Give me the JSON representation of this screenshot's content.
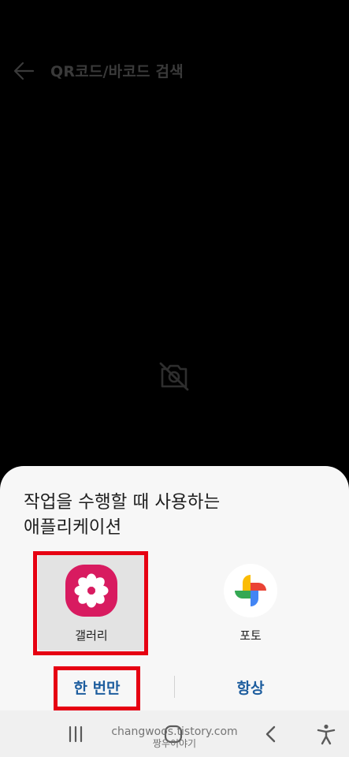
{
  "header": {
    "title": "QR코드/바코드 검색",
    "back_icon": "arrow-left-icon"
  },
  "camera": {
    "icon": "camera-off-icon"
  },
  "chooser": {
    "title": "작업을 수행할 때 사용하는\n애플리케이션",
    "apps": [
      {
        "label": "갤러리",
        "icon": "gallery-flower-icon",
        "color": "#d81b60"
      },
      {
        "label": "포토",
        "icon": "google-photos-pinwheel-icon"
      }
    ],
    "once_label": "한 번만",
    "always_label": "항상",
    "button_color": "#1d5d9e",
    "highlight_color": "#e60012"
  },
  "navbar": {
    "recents_icon": "recents-icon",
    "home_icon": "home-icon",
    "back_icon": "chevron-left-icon",
    "accessibility_icon": "accessibility-icon"
  },
  "watermark": {
    "line1": "changwoos.tistory.com",
    "line2": "짱우이야기"
  }
}
